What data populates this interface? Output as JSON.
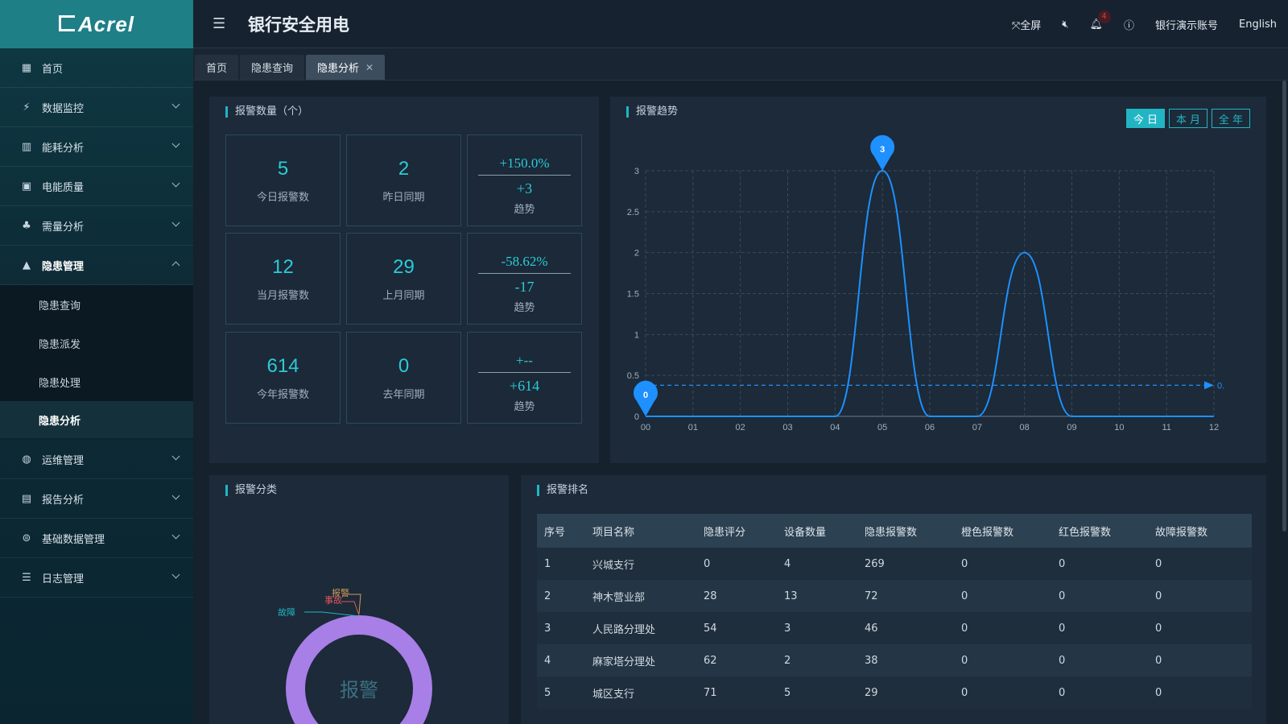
{
  "app": {
    "logo": "Acrel",
    "title": "银行安全用电"
  },
  "header": {
    "fullscreen": "全屏",
    "bell_count": "4",
    "account": "银行演示账号",
    "language": "English"
  },
  "sidebar": {
    "items": [
      {
        "label": "首页",
        "icon": "dashboard-icon"
      },
      {
        "label": "数据监控",
        "icon": "monitor-icon"
      },
      {
        "label": "能耗分析",
        "icon": "bar-chart-icon"
      },
      {
        "label": "电能质量",
        "icon": "calendar-icon"
      },
      {
        "label": "需量分析",
        "icon": "people-icon"
      },
      {
        "label": "隐患管理",
        "icon": "warning-icon"
      }
    ],
    "sub_items": [
      "隐患查询",
      "隐患派发",
      "隐患处理",
      "隐患分析"
    ],
    "lower_items": [
      {
        "label": "运维管理",
        "icon": "globe-icon"
      },
      {
        "label": "报告分析",
        "icon": "report-icon"
      },
      {
        "label": "基础数据管理",
        "icon": "database-icon"
      },
      {
        "label": "日志管理",
        "icon": "log-icon"
      }
    ]
  },
  "tabs": [
    {
      "label": "首页"
    },
    {
      "label": "隐患查询"
    },
    {
      "label": "隐患分析"
    }
  ],
  "alarm_count": {
    "title": "报警数量（个）",
    "rows": [
      {
        "current": "5",
        "current_label": "今日报警数",
        "previous": "2",
        "previous_label": "昨日同期",
        "pct": "+150.0%",
        "diff": "+3",
        "trend_label": "趋势"
      },
      {
        "current": "12",
        "current_label": "当月报警数",
        "previous": "29",
        "previous_label": "上月同期",
        "pct": "-58.62%",
        "diff": "-17",
        "trend_label": "趋势"
      },
      {
        "current": "614",
        "current_label": "今年报警数",
        "previous": "0",
        "previous_label": "去年同期",
        "pct": "+--",
        "diff": "+614",
        "trend_label": "趋势"
      }
    ]
  },
  "trend": {
    "title": "报警趋势",
    "buttons": [
      "今 日",
      "本 月",
      "全 年"
    ],
    "active_button": 0
  },
  "chart_data": {
    "type": "line",
    "x": [
      "00",
      "01",
      "02",
      "03",
      "04",
      "05",
      "06",
      "07",
      "08",
      "09",
      "10",
      "11",
      "12"
    ],
    "series": [
      {
        "values": [
          0,
          0,
          0,
          0,
          0,
          3,
          0,
          0,
          2,
          0,
          0,
          0,
          0
        ]
      }
    ],
    "ylim": [
      0,
      3
    ],
    "yticks": [
      "0",
      "0.5",
      "1",
      "1.5",
      "2",
      "2.5",
      "3"
    ],
    "markers": [
      {
        "label": "3",
        "x": "05",
        "y": 3
      },
      {
        "label": "0",
        "x": "00",
        "y": 0
      }
    ],
    "average_line": {
      "value": 0.38,
      "label": "0."
    },
    "grid": true,
    "color": "#1e90ff"
  },
  "category": {
    "title": "报警分类",
    "center_label": "报警",
    "labels": [
      {
        "text": "报警",
        "color": "#d39a5b"
      },
      {
        "text": "事故",
        "color": "#e0575a"
      },
      {
        "text": "故障",
        "color": "#21b5c4"
      }
    ],
    "ring_color": "#a77fe6"
  },
  "ranking": {
    "title": "报警排名",
    "columns": [
      "序号",
      "项目名称",
      "隐患评分",
      "设备数量",
      "隐患报警数",
      "橙色报警数",
      "红色报警数",
      "故障报警数"
    ],
    "rows": [
      [
        "1",
        "兴城支行",
        "0",
        "4",
        "269",
        "0",
        "0",
        "0"
      ],
      [
        "2",
        "神木营业部",
        "28",
        "13",
        "72",
        "0",
        "0",
        "0"
      ],
      [
        "3",
        "人民路分理处",
        "54",
        "3",
        "46",
        "0",
        "0",
        "0"
      ],
      [
        "4",
        "麻家塔分理处",
        "62",
        "2",
        "38",
        "0",
        "0",
        "0"
      ],
      [
        "5",
        "城区支行",
        "71",
        "5",
        "29",
        "0",
        "0",
        "0"
      ]
    ]
  }
}
